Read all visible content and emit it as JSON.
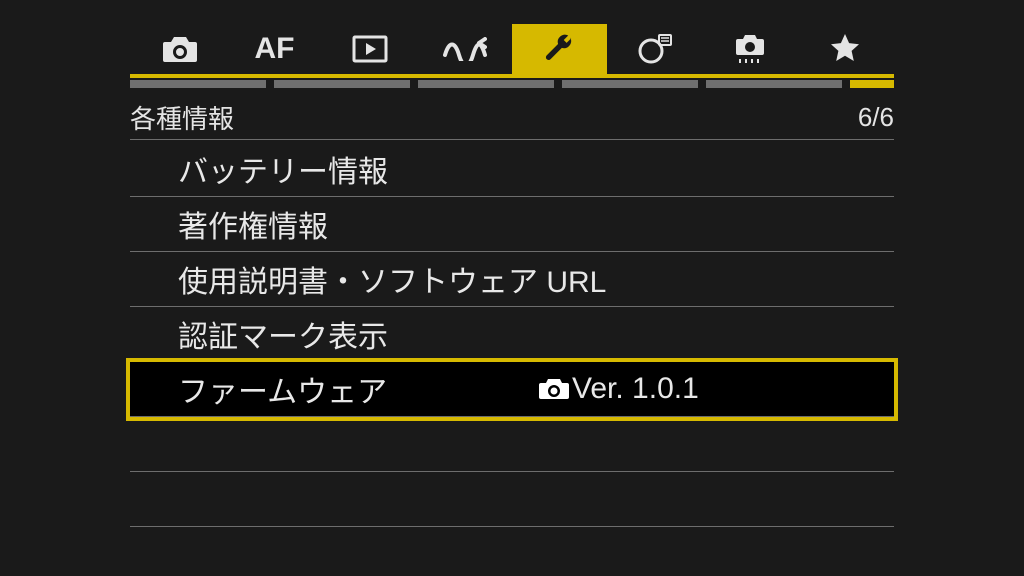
{
  "tabs": {
    "active_index": 4,
    "items": [
      {
        "name": "camera-icon"
      },
      {
        "name": "af-icon",
        "text": "AF"
      },
      {
        "name": "playback-icon"
      },
      {
        "name": "wireless-icon"
      },
      {
        "name": "wrench-icon"
      },
      {
        "name": "level-icon"
      },
      {
        "name": "custom-icon"
      },
      {
        "name": "star-icon"
      }
    ]
  },
  "subpage": {
    "count": 6,
    "active": 6
  },
  "section": {
    "title": "各種情報",
    "page_indicator": "6/6"
  },
  "menu": {
    "items": [
      {
        "label": "バッテリー情報",
        "selected": false
      },
      {
        "label": "著作権情報",
        "selected": false
      },
      {
        "label": "使用説明書・ソフトウェア URL",
        "selected": false
      },
      {
        "label": "認証マーク表示",
        "selected": false
      },
      {
        "label": "ファームウェア",
        "value_prefix_icon": "camera-icon",
        "value": "Ver. 1.0.1",
        "selected": true
      }
    ]
  }
}
